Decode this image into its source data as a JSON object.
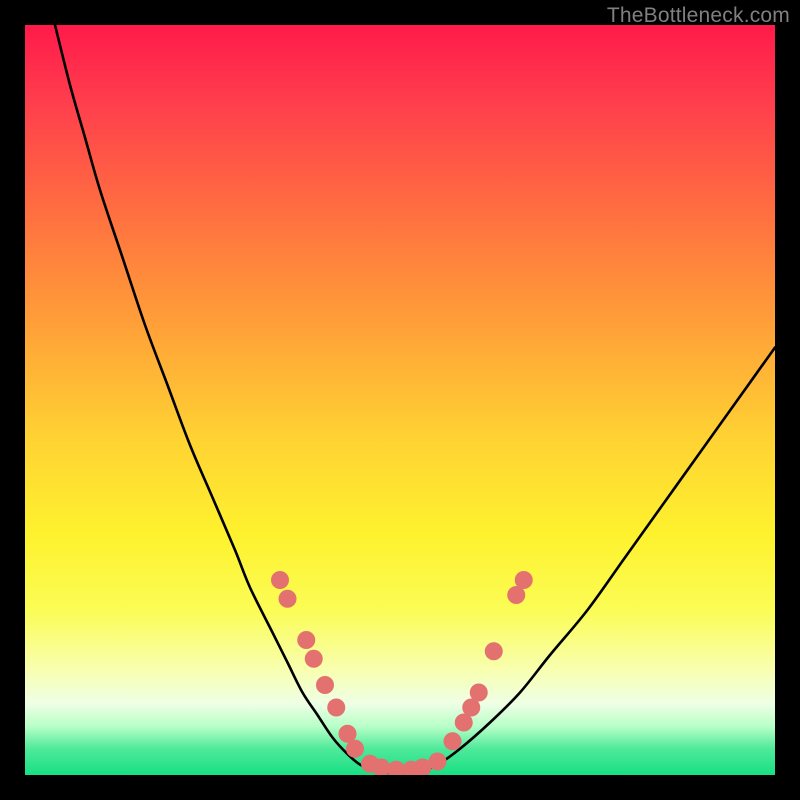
{
  "watermark": "TheBottleneck.com",
  "chart_data": {
    "type": "line",
    "title": "",
    "xlabel": "",
    "ylabel": "",
    "x_range": [
      0,
      100
    ],
    "y_range": [
      0,
      100
    ],
    "background_gradient": {
      "stops": [
        {
          "pos": 0.0,
          "color": "#ff1a4a"
        },
        {
          "pos": 0.1,
          "color": "#ff3d4d"
        },
        {
          "pos": 0.25,
          "color": "#ff6f40"
        },
        {
          "pos": 0.4,
          "color": "#ffa038"
        },
        {
          "pos": 0.55,
          "color": "#ffd233"
        },
        {
          "pos": 0.68,
          "color": "#fef22e"
        },
        {
          "pos": 0.78,
          "color": "#fbfc55"
        },
        {
          "pos": 0.86,
          "color": "#f8ffb0"
        },
        {
          "pos": 0.905,
          "color": "#eeffe5"
        },
        {
          "pos": 0.935,
          "color": "#b8ffc8"
        },
        {
          "pos": 0.965,
          "color": "#4fe99a"
        },
        {
          "pos": 1.0,
          "color": "#17e083"
        }
      ]
    },
    "series": [
      {
        "name": "bottleneck-curve",
        "color": "#000000",
        "x": [
          4,
          6,
          8,
          10,
          13,
          16,
          19,
          22,
          25,
          28,
          30,
          33,
          35,
          37,
          39,
          41,
          43,
          45,
          48,
          52,
          55,
          58,
          62,
          66,
          70,
          75,
          80,
          85,
          90,
          95,
          100
        ],
        "y": [
          100,
          92,
          85,
          78,
          69,
          60,
          52,
          44,
          37,
          30,
          25,
          19,
          15,
          11,
          8,
          5,
          2.8,
          1.2,
          0.3,
          0.3,
          1.4,
          3.5,
          7,
          11,
          16,
          22,
          29,
          36,
          43,
          50,
          57
        ]
      }
    ],
    "markers": {
      "name": "curve-dots",
      "color": "#e3716f",
      "radius": 9,
      "points": [
        {
          "x": 34.0,
          "y": 26.0
        },
        {
          "x": 35.0,
          "y": 23.5
        },
        {
          "x": 37.5,
          "y": 18.0
        },
        {
          "x": 38.5,
          "y": 15.5
        },
        {
          "x": 40.0,
          "y": 12.0
        },
        {
          "x": 41.5,
          "y": 9.0
        },
        {
          "x": 43.0,
          "y": 5.5
        },
        {
          "x": 44.0,
          "y": 3.5
        },
        {
          "x": 46.0,
          "y": 1.5
        },
        {
          "x": 47.5,
          "y": 1.0
        },
        {
          "x": 49.5,
          "y": 0.7
        },
        {
          "x": 51.5,
          "y": 0.7
        },
        {
          "x": 53.0,
          "y": 1.0
        },
        {
          "x": 55.0,
          "y": 1.8
        },
        {
          "x": 57.0,
          "y": 4.5
        },
        {
          "x": 58.5,
          "y": 7.0
        },
        {
          "x": 59.5,
          "y": 9.0
        },
        {
          "x": 60.5,
          "y": 11.0
        },
        {
          "x": 62.5,
          "y": 16.5
        },
        {
          "x": 65.5,
          "y": 24.0
        },
        {
          "x": 66.5,
          "y": 26.0
        }
      ]
    }
  }
}
